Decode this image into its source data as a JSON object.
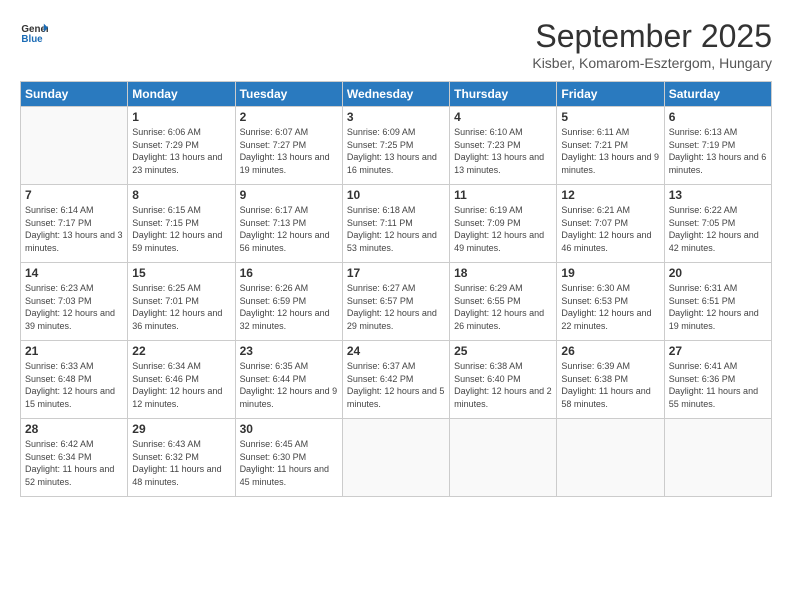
{
  "header": {
    "logo_general": "General",
    "logo_blue": "Blue",
    "month": "September 2025",
    "location": "Kisber, Komarom-Esztergom, Hungary"
  },
  "days_of_week": [
    "Sunday",
    "Monday",
    "Tuesday",
    "Wednesday",
    "Thursday",
    "Friday",
    "Saturday"
  ],
  "weeks": [
    [
      {
        "day": "",
        "sunrise": "",
        "sunset": "",
        "daylight": ""
      },
      {
        "day": "1",
        "sunrise": "Sunrise: 6:06 AM",
        "sunset": "Sunset: 7:29 PM",
        "daylight": "Daylight: 13 hours and 23 minutes."
      },
      {
        "day": "2",
        "sunrise": "Sunrise: 6:07 AM",
        "sunset": "Sunset: 7:27 PM",
        "daylight": "Daylight: 13 hours and 19 minutes."
      },
      {
        "day": "3",
        "sunrise": "Sunrise: 6:09 AM",
        "sunset": "Sunset: 7:25 PM",
        "daylight": "Daylight: 13 hours and 16 minutes."
      },
      {
        "day": "4",
        "sunrise": "Sunrise: 6:10 AM",
        "sunset": "Sunset: 7:23 PM",
        "daylight": "Daylight: 13 hours and 13 minutes."
      },
      {
        "day": "5",
        "sunrise": "Sunrise: 6:11 AM",
        "sunset": "Sunset: 7:21 PM",
        "daylight": "Daylight: 13 hours and 9 minutes."
      },
      {
        "day": "6",
        "sunrise": "Sunrise: 6:13 AM",
        "sunset": "Sunset: 7:19 PM",
        "daylight": "Daylight: 13 hours and 6 minutes."
      }
    ],
    [
      {
        "day": "7",
        "sunrise": "Sunrise: 6:14 AM",
        "sunset": "Sunset: 7:17 PM",
        "daylight": "Daylight: 13 hours and 3 minutes."
      },
      {
        "day": "8",
        "sunrise": "Sunrise: 6:15 AM",
        "sunset": "Sunset: 7:15 PM",
        "daylight": "Daylight: 12 hours and 59 minutes."
      },
      {
        "day": "9",
        "sunrise": "Sunrise: 6:17 AM",
        "sunset": "Sunset: 7:13 PM",
        "daylight": "Daylight: 12 hours and 56 minutes."
      },
      {
        "day": "10",
        "sunrise": "Sunrise: 6:18 AM",
        "sunset": "Sunset: 7:11 PM",
        "daylight": "Daylight: 12 hours and 53 minutes."
      },
      {
        "day": "11",
        "sunrise": "Sunrise: 6:19 AM",
        "sunset": "Sunset: 7:09 PM",
        "daylight": "Daylight: 12 hours and 49 minutes."
      },
      {
        "day": "12",
        "sunrise": "Sunrise: 6:21 AM",
        "sunset": "Sunset: 7:07 PM",
        "daylight": "Daylight: 12 hours and 46 minutes."
      },
      {
        "day": "13",
        "sunrise": "Sunrise: 6:22 AM",
        "sunset": "Sunset: 7:05 PM",
        "daylight": "Daylight: 12 hours and 42 minutes."
      }
    ],
    [
      {
        "day": "14",
        "sunrise": "Sunrise: 6:23 AM",
        "sunset": "Sunset: 7:03 PM",
        "daylight": "Daylight: 12 hours and 39 minutes."
      },
      {
        "day": "15",
        "sunrise": "Sunrise: 6:25 AM",
        "sunset": "Sunset: 7:01 PM",
        "daylight": "Daylight: 12 hours and 36 minutes."
      },
      {
        "day": "16",
        "sunrise": "Sunrise: 6:26 AM",
        "sunset": "Sunset: 6:59 PM",
        "daylight": "Daylight: 12 hours and 32 minutes."
      },
      {
        "day": "17",
        "sunrise": "Sunrise: 6:27 AM",
        "sunset": "Sunset: 6:57 PM",
        "daylight": "Daylight: 12 hours and 29 minutes."
      },
      {
        "day": "18",
        "sunrise": "Sunrise: 6:29 AM",
        "sunset": "Sunset: 6:55 PM",
        "daylight": "Daylight: 12 hours and 26 minutes."
      },
      {
        "day": "19",
        "sunrise": "Sunrise: 6:30 AM",
        "sunset": "Sunset: 6:53 PM",
        "daylight": "Daylight: 12 hours and 22 minutes."
      },
      {
        "day": "20",
        "sunrise": "Sunrise: 6:31 AM",
        "sunset": "Sunset: 6:51 PM",
        "daylight": "Daylight: 12 hours and 19 minutes."
      }
    ],
    [
      {
        "day": "21",
        "sunrise": "Sunrise: 6:33 AM",
        "sunset": "Sunset: 6:48 PM",
        "daylight": "Daylight: 12 hours and 15 minutes."
      },
      {
        "day": "22",
        "sunrise": "Sunrise: 6:34 AM",
        "sunset": "Sunset: 6:46 PM",
        "daylight": "Daylight: 12 hours and 12 minutes."
      },
      {
        "day": "23",
        "sunrise": "Sunrise: 6:35 AM",
        "sunset": "Sunset: 6:44 PM",
        "daylight": "Daylight: 12 hours and 9 minutes."
      },
      {
        "day": "24",
        "sunrise": "Sunrise: 6:37 AM",
        "sunset": "Sunset: 6:42 PM",
        "daylight": "Daylight: 12 hours and 5 minutes."
      },
      {
        "day": "25",
        "sunrise": "Sunrise: 6:38 AM",
        "sunset": "Sunset: 6:40 PM",
        "daylight": "Daylight: 12 hours and 2 minutes."
      },
      {
        "day": "26",
        "sunrise": "Sunrise: 6:39 AM",
        "sunset": "Sunset: 6:38 PM",
        "daylight": "Daylight: 11 hours and 58 minutes."
      },
      {
        "day": "27",
        "sunrise": "Sunrise: 6:41 AM",
        "sunset": "Sunset: 6:36 PM",
        "daylight": "Daylight: 11 hours and 55 minutes."
      }
    ],
    [
      {
        "day": "28",
        "sunrise": "Sunrise: 6:42 AM",
        "sunset": "Sunset: 6:34 PM",
        "daylight": "Daylight: 11 hours and 52 minutes."
      },
      {
        "day": "29",
        "sunrise": "Sunrise: 6:43 AM",
        "sunset": "Sunset: 6:32 PM",
        "daylight": "Daylight: 11 hours and 48 minutes."
      },
      {
        "day": "30",
        "sunrise": "Sunrise: 6:45 AM",
        "sunset": "Sunset: 6:30 PM",
        "daylight": "Daylight: 11 hours and 45 minutes."
      },
      {
        "day": "",
        "sunrise": "",
        "sunset": "",
        "daylight": ""
      },
      {
        "day": "",
        "sunrise": "",
        "sunset": "",
        "daylight": ""
      },
      {
        "day": "",
        "sunrise": "",
        "sunset": "",
        "daylight": ""
      },
      {
        "day": "",
        "sunrise": "",
        "sunset": "",
        "daylight": ""
      }
    ]
  ]
}
